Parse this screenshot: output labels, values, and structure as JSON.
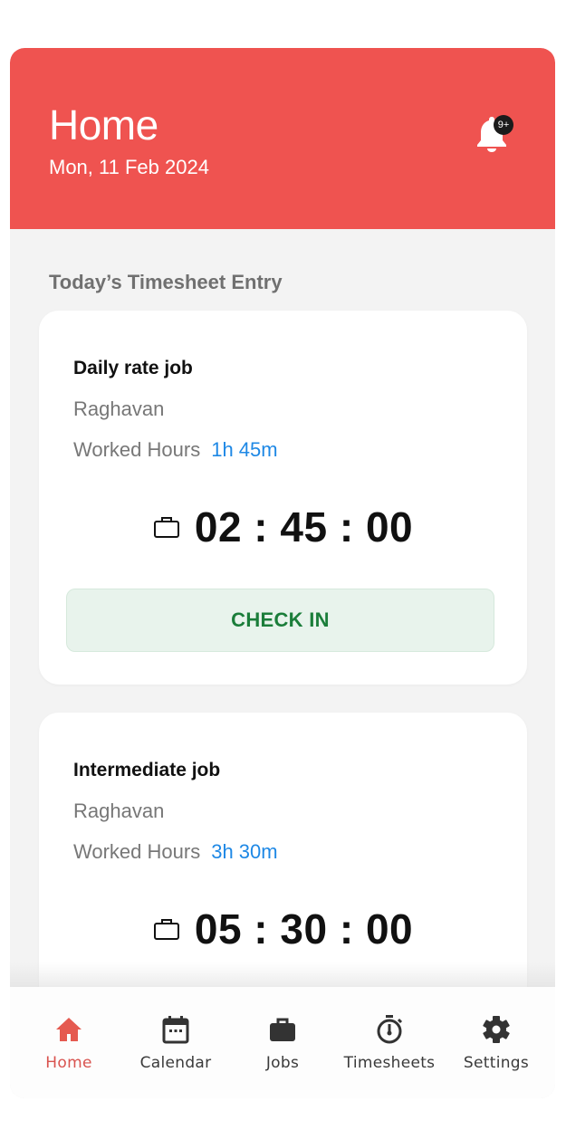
{
  "header": {
    "title": "Home",
    "date": "Mon, 11 Feb 2024",
    "notification_badge": "9+",
    "accent_color": "#ef5350"
  },
  "section_title": "Today’s Timesheet Entry",
  "jobs": [
    {
      "title": "Daily rate job",
      "person": "Raghavan",
      "worked_label": "Worked Hours",
      "worked_value": "1h 45m",
      "timer": "02 : 45 : 00",
      "action_label": "CHECK IN"
    },
    {
      "title": "Intermediate job",
      "person": "Raghavan",
      "worked_label": "Worked Hours",
      "worked_value": "3h 30m",
      "timer": "05 : 30 : 00"
    }
  ],
  "nav": {
    "items": [
      {
        "label": "Home",
        "icon": "home-icon",
        "active": true
      },
      {
        "label": "Calendar",
        "icon": "calendar-icon",
        "active": false
      },
      {
        "label": "Jobs",
        "icon": "briefcase-icon",
        "active": false
      },
      {
        "label": "Timesheets",
        "icon": "stopwatch-icon",
        "active": false
      },
      {
        "label": "Settings",
        "icon": "gear-icon",
        "active": false
      }
    ]
  }
}
